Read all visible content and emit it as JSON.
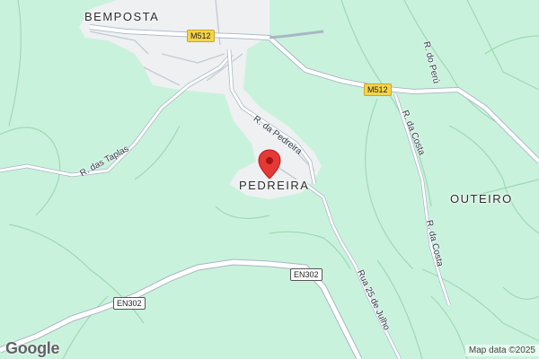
{
  "map": {
    "colors": {
      "land": "#c9f2dc",
      "urban": "#eef0f2",
      "road": "#ffffff",
      "road_edge": "#a9b6c4",
      "minor_road": "#a5ddb8",
      "pin": "#e53935"
    },
    "places": {
      "bemposta": "BEMPOSTA",
      "pedreira": "PEDREIRA",
      "outeiro": "OUTEIRO"
    },
    "roads": {
      "r_da_pedreira": "R. da Pedreira",
      "r_das_taplas": "R. das Taplas",
      "r_do_peru": "R. do Perú",
      "r_da_costa_1": "R. da Costa",
      "r_da_costa_2": "R. da Costa",
      "rua_25_de_julho": "Rua 25 de Julho"
    },
    "shields": {
      "m512_a": "M512",
      "m512_b": "M512",
      "en302_a": "EN302",
      "en302_b": "EN302"
    },
    "marker_icon": "map-pin-icon",
    "logo": "Google",
    "attribution": "Map data ©2025"
  }
}
